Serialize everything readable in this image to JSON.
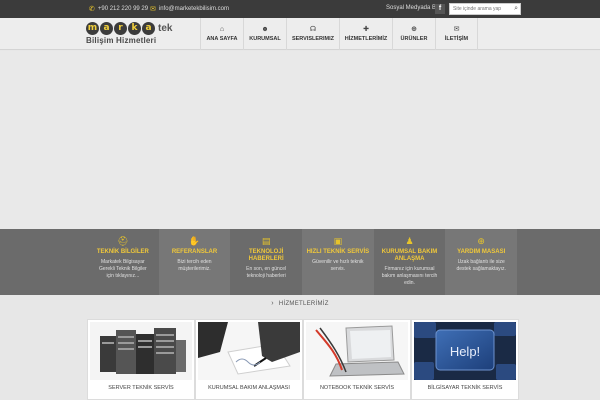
{
  "topbar": {
    "phone": "+90 212 220 99 29",
    "email": "info@marketekbilisim.com",
    "social_label": "Sosyal Medyada Biz",
    "facebook": "f",
    "search_placeholder": "Site içinde arama yap"
  },
  "logo": {
    "letters": [
      "m",
      "a",
      "r",
      "k",
      "a"
    ],
    "tek": "tek",
    "subtitle": "Bilişim Hizmetleri"
  },
  "nav": [
    {
      "label": "ANA SAYFA",
      "icon": "home-icon"
    },
    {
      "label": "KURUMSAL",
      "icon": "people-icon"
    },
    {
      "label": "SERVISLERIMIZ",
      "icon": "headset-icon"
    },
    {
      "label": "HİZMETLERİMİZ",
      "icon": "plus-icon"
    },
    {
      "label": "ÜRÜNLER",
      "icon": "plus-circle-icon"
    },
    {
      "label": "İLETİŞİM",
      "icon": "envelope-icon"
    }
  ],
  "features": [
    {
      "title": "TEKNİK BİLGİLER",
      "text": "Markatek Bilgisayar Gerekli Teknik Bilgiler için tıklayınız...",
      "icon": "helmet-icon"
    },
    {
      "title": "REFERANSLAR",
      "text": "Bizi tercih eden müşterilerimiz.",
      "icon": "handshake-icon"
    },
    {
      "title": "TEKNOLOJİ HABERLERİ",
      "text": "En son, en güncel teknoloji haberleri",
      "icon": "newspaper-icon"
    },
    {
      "title": "HIZLI TEKNİK SERVİS",
      "text": "Güvenilir ve hızlı teknik servis.",
      "icon": "briefcase-icon"
    },
    {
      "title": "KURUMSAL BAKIM ANLAŞMA",
      "text": "Firmanız için kurumsal bakım anlaşmasını tercih edin.",
      "icon": "group-icon"
    },
    {
      "title": "YARDIM MASASI",
      "text": "Uzak bağlantı ile size destek sağlamaktayız.",
      "icon": "plus-circle-icon"
    }
  ],
  "section_title": "HİZMETLERİMİZ",
  "cards": [
    {
      "title": "SERVER TEKNİK SERVİS"
    },
    {
      "title": "KURUMSAL BAKIM ANLAŞMASI"
    },
    {
      "title": "NOTEBOOK TEKNİK SERVİS"
    },
    {
      "title": "BİLGİSAYAR TEKNİK SERVİS",
      "key_text": "Help!"
    }
  ],
  "colors": {
    "accent": "#f0c83a",
    "topbar_bg": "#3b3b3b",
    "band_bg": "#6b6b6b"
  }
}
